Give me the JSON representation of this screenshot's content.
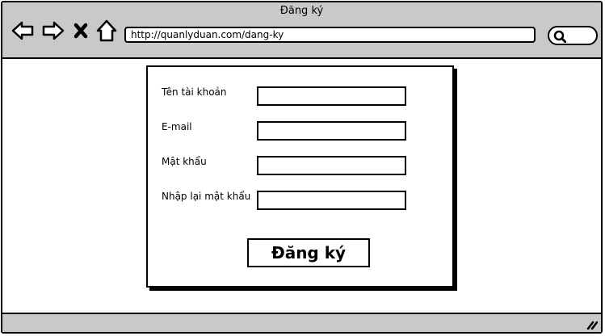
{
  "window": {
    "title": "Đăng ký"
  },
  "browser": {
    "url": "http://quanlyduan.com/dang-ky",
    "nav_icons": [
      "back-arrow-icon",
      "forward-arrow-icon",
      "close-x-icon",
      "home-icon"
    ],
    "search_icon": "search-icon"
  },
  "form": {
    "fields": [
      {
        "label": "Tên tài khoản",
        "value": ""
      },
      {
        "label": "E-mail",
        "value": ""
      },
      {
        "label": "Mật khẩu",
        "value": ""
      },
      {
        "label": "Nhập lại mật khẩu",
        "value": ""
      }
    ],
    "submit_label": "Đăng ký"
  },
  "colors": {
    "chrome": "#c9c9c9",
    "background": "#ffffff",
    "stroke": "#000000"
  }
}
